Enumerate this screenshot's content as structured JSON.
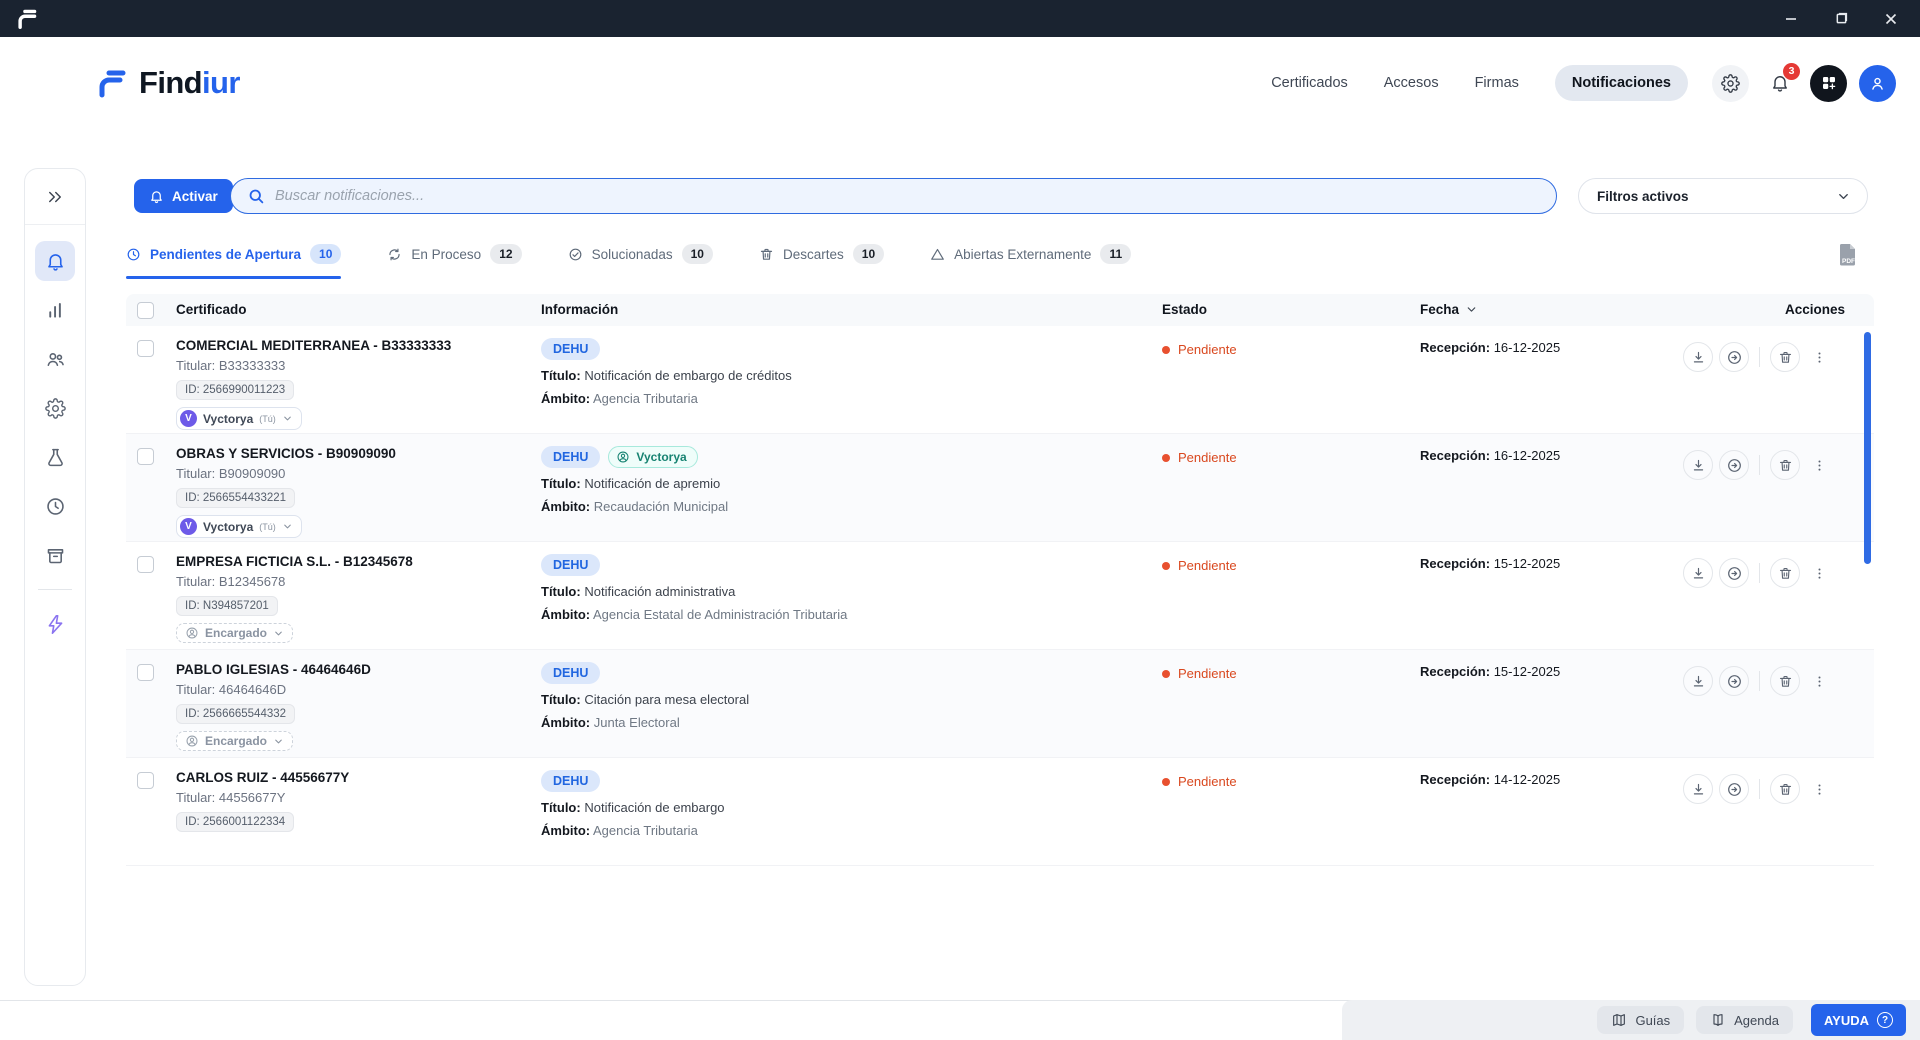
{
  "brand": {
    "first": "Find",
    "second": "iur"
  },
  "nav": {
    "items": [
      "Certificados",
      "Accesos",
      "Firmas",
      "Notificaciones"
    ],
    "bell_count": "3"
  },
  "toolbar": {
    "activar": "Activar",
    "search_placeholder": "Buscar notificaciones...",
    "filtros": "Filtros activos"
  },
  "tabs": [
    {
      "label": "Pendientes de Apertura",
      "count": "10"
    },
    {
      "label": "En Proceso",
      "count": "12"
    },
    {
      "label": "Solucionadas",
      "count": "10"
    },
    {
      "label": "Descartes",
      "count": "10"
    },
    {
      "label": "Abiertas Externamente",
      "count": "11"
    }
  ],
  "table": {
    "headers": {
      "certificado": "Certificado",
      "informacion": "Información",
      "estado": "Estado",
      "fecha": "Fecha",
      "acciones": "Acciones"
    },
    "labels": {
      "titular": "Titular:",
      "titulo": "Título:",
      "ambito": "Ámbito:",
      "recepcion": "Recepción:",
      "tu": "(Tú)"
    },
    "rows": [
      {
        "name": "COMERCIAL MEDITERRANEA - B33333333",
        "titular": "B33333333",
        "id": "ID: 2566990011223",
        "owner": "Vyctorya",
        "owner_initial": "V",
        "channel": "DEHU",
        "titulo": "Notificación de embargo de créditos",
        "ambito": "Agencia Tributaria",
        "estado": "Pendiente",
        "fecha": "16-12-2025"
      },
      {
        "name": "OBRAS Y SERVICIOS - B90909090",
        "titular": "B90909090",
        "id": "ID: 2566554433221",
        "owner": "Vyctorya",
        "owner_initial": "V",
        "channel": "DEHU",
        "assignee": "Vyctorya",
        "titulo": "Notificación de apremio",
        "ambito": "Recaudación Municipal",
        "estado": "Pendiente",
        "fecha": "16-12-2025"
      },
      {
        "name": "EMPRESA FICTICIA S.L. - B12345678",
        "titular": "B12345678",
        "id": "ID: N394857201",
        "owner": "Encargado",
        "channel": "DEHU",
        "titulo": "Notificación administrativa",
        "ambito": "Agencia Estatal de Administración Tributaria",
        "estado": "Pendiente",
        "fecha": "15-12-2025"
      },
      {
        "name": "PABLO IGLESIAS - 46464646D",
        "titular": "46464646D",
        "id": "ID: 2566665544332",
        "owner": "Encargado",
        "channel": "DEHU",
        "titulo": "Citación para mesa electoral",
        "ambito": "Junta Electoral",
        "estado": "Pendiente",
        "fecha": "15-12-2025"
      },
      {
        "name": "CARLOS RUIZ - 44556677Y",
        "titular": "44556677Y",
        "id": "ID: 2566001122334",
        "channel": "DEHU",
        "titulo": "Notificación de embargo",
        "ambito": "Agencia Tributaria",
        "estado": "Pendiente",
        "fecha": "14-12-2025"
      }
    ]
  },
  "footer": {
    "guias": "Guías",
    "agenda": "Agenda",
    "ayuda": "AYUDA",
    "help_q": "?"
  }
}
